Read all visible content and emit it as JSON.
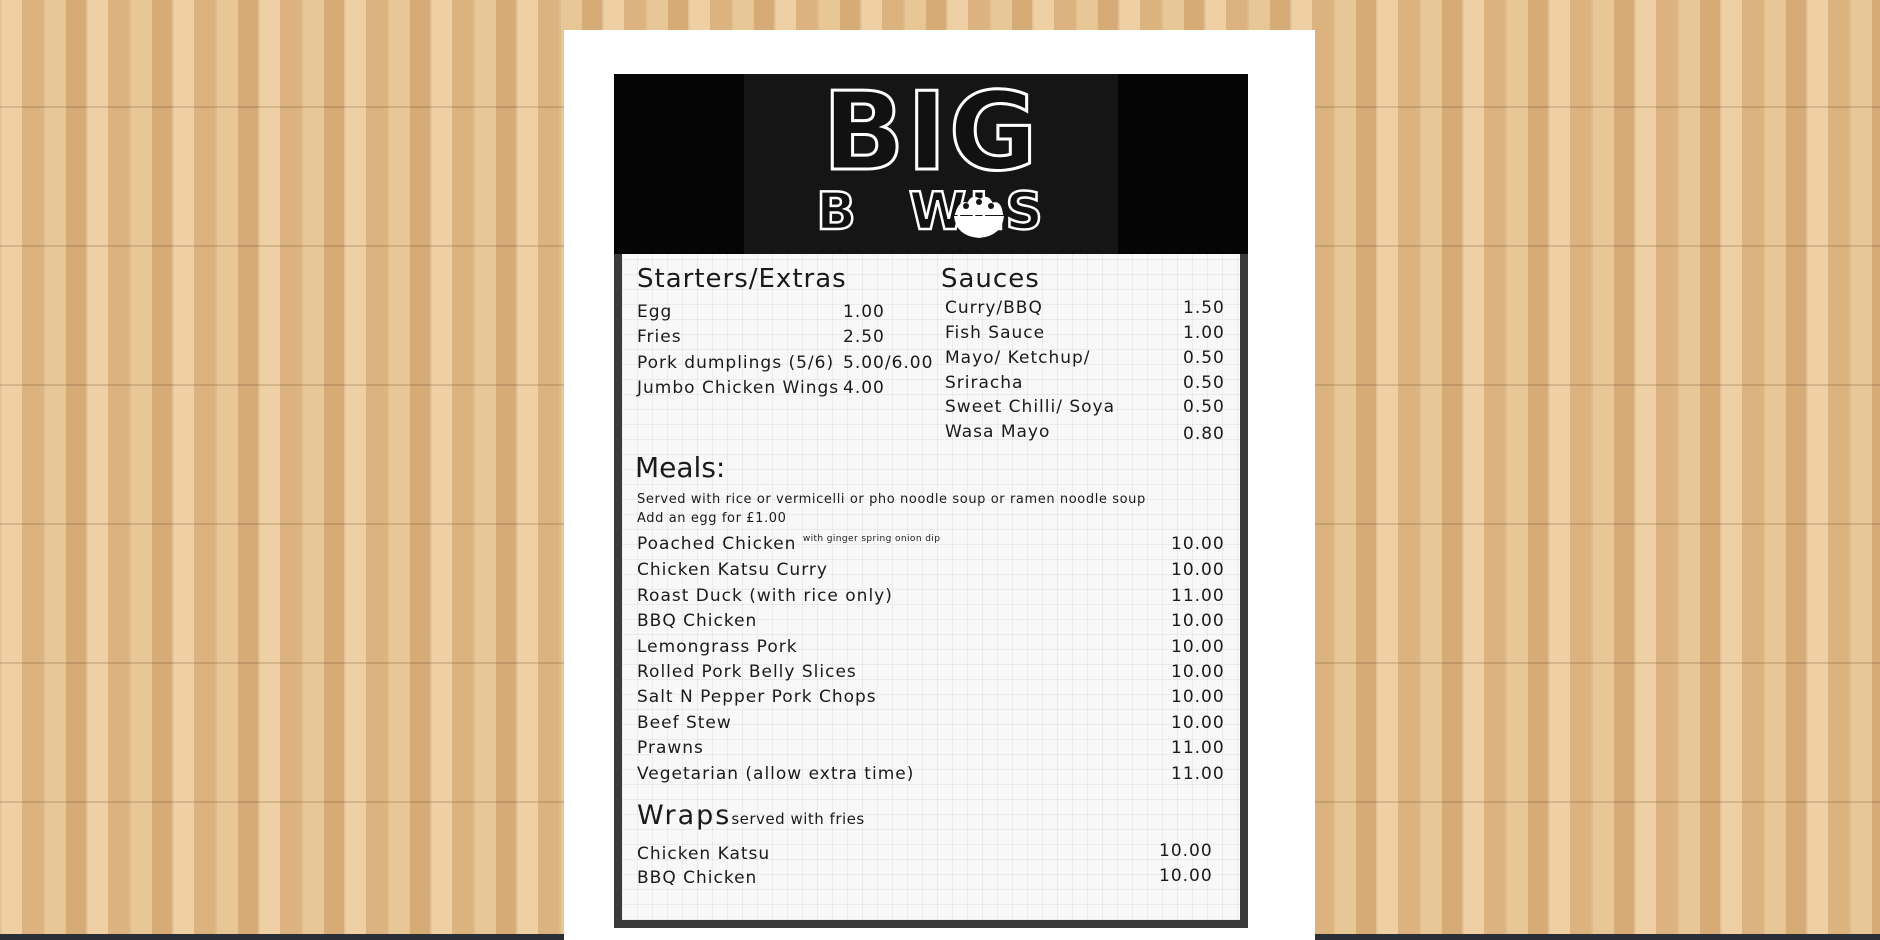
{
  "logo": {
    "line1": "BIG",
    "line2_pre": "B",
    "line2_post": "WLS"
  },
  "starters": {
    "heading": "Starters/Extras",
    "items": [
      {
        "name": "Egg",
        "price": "1.00"
      },
      {
        "name": "Fries",
        "price": "2.50"
      },
      {
        "name": "Pork dumplings (5/6)",
        "price": "5.00/6.00"
      },
      {
        "name": "Jumbo Chicken Wings",
        "price": "4.00"
      }
    ]
  },
  "sauces": {
    "heading": "Sauces",
    "items": [
      {
        "name": "Curry/BBQ",
        "price": "1.50"
      },
      {
        "name": "Fish Sauce",
        "price": "1.00"
      },
      {
        "name": "Mayo/ Ketchup/",
        "price": "0.50"
      },
      {
        "name": "Sriracha",
        "price": "0.50"
      },
      {
        "name": "Sweet Chilli/ Soya",
        "price": "0.50"
      },
      {
        "name": "Wasa Mayo",
        "price": "0.80"
      }
    ]
  },
  "meals": {
    "heading": "Meals:",
    "note1": "Served with rice or vermicelli or pho noodle soup or ramen noodle soup",
    "note2": "Add an egg for £1.00",
    "items": [
      {
        "name": "Poached Chicken",
        "extra": "with ginger spring onion dip",
        "price": "10.00"
      },
      {
        "name": "Chicken Katsu Curry",
        "price": "10.00"
      },
      {
        "name": "Roast Duck (with rice only)",
        "price": "11.00"
      },
      {
        "name": "BBQ Chicken",
        "price": "10.00"
      },
      {
        "name": "Lemongrass Pork",
        "price": "10.00"
      },
      {
        "name": "Rolled Pork Belly Slices",
        "price": "10.00"
      },
      {
        "name": "Salt N Pepper Pork Chops",
        "price": "10.00"
      },
      {
        "name": "Beef Stew",
        "price": "10.00"
      },
      {
        "name": "Prawns",
        "price": "11.00"
      },
      {
        "name": "Vegetarian (allow extra time)",
        "price": "11.00"
      }
    ]
  },
  "wraps": {
    "heading": "Wraps",
    "subheading": "served with fries",
    "items": [
      {
        "name": "Chicken Katsu",
        "price": "10.00"
      },
      {
        "name": "BBQ Chicken",
        "price": "10.00"
      }
    ]
  },
  "colors": {
    "header_bg": "#050505",
    "frame": "#3a3a3a",
    "text": "#1a1a1a",
    "paper": "#ffffff"
  }
}
